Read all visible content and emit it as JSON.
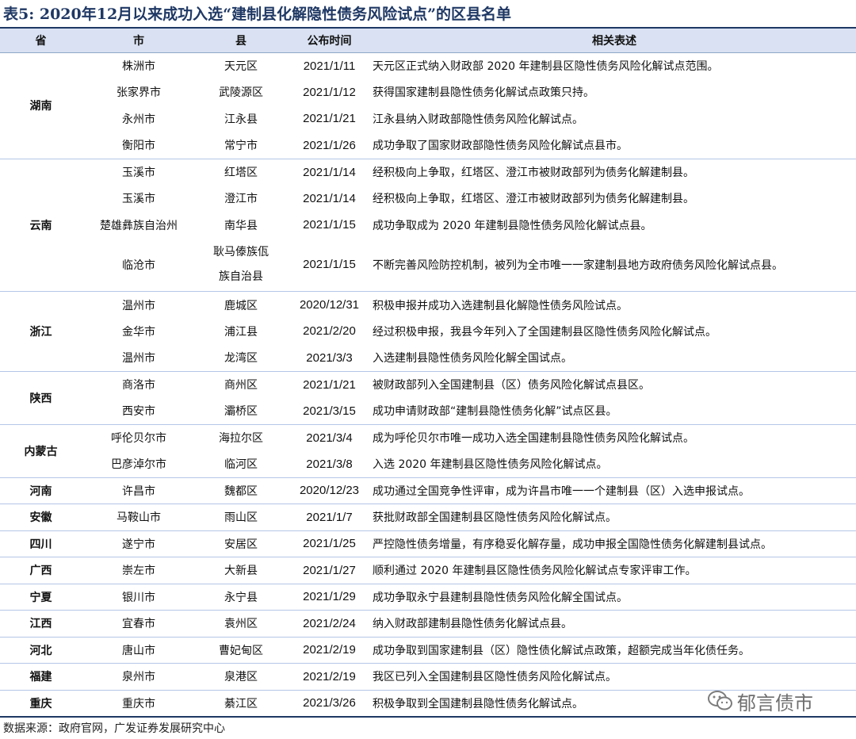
{
  "title": "表5:  2020年12月以来成功入选“建制县化解隐性债务风险试点”的区县名单",
  "headers": [
    "省",
    "市",
    "县",
    "公布时间",
    "相关表述"
  ],
  "groups": [
    {
      "province": "湖南",
      "rows": [
        {
          "city": "株洲市",
          "county": "天元区",
          "date": "2021/1/11",
          "desc": "天元区正式纳入财政部 2020 年建制县区隐性债务风险化解试点范围。"
        },
        {
          "city": "张家界市",
          "county": "武陵源区",
          "date": "2021/1/12",
          "desc": "获得国家建制县隐性债务化解试点政策只持。"
        },
        {
          "city": "永州市",
          "county": "江永县",
          "date": "2021/1/21",
          "desc": "江永县纳入财政部隐性债务风险化解试点。"
        },
        {
          "city": "衡阳市",
          "county": "常宁市",
          "date": "2021/1/26",
          "desc": "成功争取了国家财政部隐性债务风险化解试点县市。"
        }
      ]
    },
    {
      "province": "云南",
      "rows": [
        {
          "city": "玉溪市",
          "county": "红塔区",
          "date": "2021/1/14",
          "desc": "经积极向上争取，红塔区、澄江市被财政部列为债务化解建制县。"
        },
        {
          "city": "玉溪市",
          "county": "澄江市",
          "date": "2021/1/14",
          "desc": "经积极向上争取，红塔区、澄江市被财政部列为债务化解建制县。"
        },
        {
          "city": "楚雄彝族自治州",
          "county": "南华县",
          "date": "2021/1/15",
          "desc": "成功争取成为 2020 年建制县隐性债务风险化解试点县。"
        },
        {
          "city": "临沧市",
          "county": "耿马傣族佤族自治县",
          "county_line1": "耿马傣族佤",
          "county_line2": "族自治县",
          "date": "2021/1/15",
          "desc": "不断完善风险防控机制，被列为全市唯一一家建制县地方政府债务风险化解试点县。"
        }
      ]
    },
    {
      "province": "浙江",
      "rows": [
        {
          "city": "温州市",
          "county": "鹿城区",
          "date": "2020/12/31",
          "desc": "积极申报并成功入选建制县化解隐性债务风险试点。"
        },
        {
          "city": "金华市",
          "county": "浦江县",
          "date": "2021/2/20",
          "desc": "经过积极申报，我县今年列入了全国建制县区隐性债务风险化解试点。"
        },
        {
          "city": "温州市",
          "county": "龙湾区",
          "date": "2021/3/3",
          "desc": "入选建制县隐性债务风险化解全国试点。"
        }
      ]
    },
    {
      "province": "陕西",
      "rows": [
        {
          "city": "商洛市",
          "county": "商州区",
          "date": "2021/1/21",
          "desc": "被财政部列入全国建制县（区）债务风险化解试点县区。"
        },
        {
          "city": "西安市",
          "county": "灞桥区",
          "date": "2021/3/15",
          "desc": "成功申请财政部“建制县隐性债务化解”试点区县。"
        }
      ]
    },
    {
      "province": "内蒙古",
      "rows": [
        {
          "city": "呼伦贝尔市",
          "county": "海拉尔区",
          "date": "2021/3/4",
          "desc": "成为呼伦贝尔市唯一成功入选全国建制县隐性债务风险化解试点。"
        },
        {
          "city": "巴彦淖尔市",
          "county": "临河区",
          "date": "2021/3/8",
          "desc": "入选 2020 年建制县区隐性债务风险化解试点。"
        }
      ]
    },
    {
      "province": "河南",
      "rows": [
        {
          "city": "许昌市",
          "county": "魏都区",
          "date": "2020/12/23",
          "desc": "成功通过全国竞争性评审，成为许昌市唯一一个建制县（区）入选申报试点。"
        }
      ]
    },
    {
      "province": "安徽",
      "rows": [
        {
          "city": "马鞍山市",
          "county": "雨山区",
          "date": "2021/1/7",
          "desc": "获批财政部全国建制县区隐性债务风险化解试点。"
        }
      ]
    },
    {
      "province": "四川",
      "rows": [
        {
          "city": "遂宁市",
          "county": "安居区",
          "date": "2021/1/25",
          "desc": "严控隐性债务增量，有序稳妥化解存量，成功申报全国隐性债务化解建制县试点。"
        }
      ]
    },
    {
      "province": "广西",
      "rows": [
        {
          "city": "崇左市",
          "county": "大新县",
          "date": "2021/1/27",
          "desc": "顺利通过 2020 年建制县区隐性债务风险化解试点专家评审工作。"
        }
      ]
    },
    {
      "province": "宁夏",
      "rows": [
        {
          "city": "银川市",
          "county": "永宁县",
          "date": "2021/1/29",
          "desc": "成功争取永宁县建制县隐性债务风险化解全国试点。"
        }
      ]
    },
    {
      "province": "江西",
      "rows": [
        {
          "city": "宜春市",
          "county": "袁州区",
          "date": "2021/2/24",
          "desc": "纳入财政部建制县隐性债务化解试点县。"
        }
      ]
    },
    {
      "province": "河北",
      "rows": [
        {
          "city": "唐山市",
          "county": "曹妃甸区",
          "date": "2021/2/19",
          "desc": "成功争取到国家建制县（区）隐性债化解试点政策，超额完成当年化债任务。"
        }
      ]
    },
    {
      "province": "福建",
      "rows": [
        {
          "city": "泉州市",
          "county": "泉港区",
          "date": "2021/2/19",
          "desc": "我区已列入全国建制县区隐性债务风险化解试点。"
        }
      ]
    },
    {
      "province": "重庆",
      "rows": [
        {
          "city": "重庆市",
          "county": "綦江区",
          "date": "2021/3/26",
          "desc": "积极争取到全国建制县隐性债务化解试点。"
        }
      ]
    }
  ],
  "source": "数据来源：政府官网，广发证券发展研究中心",
  "watermark": {
    "text": "郁言债市",
    "icon": "wechat-icon"
  }
}
